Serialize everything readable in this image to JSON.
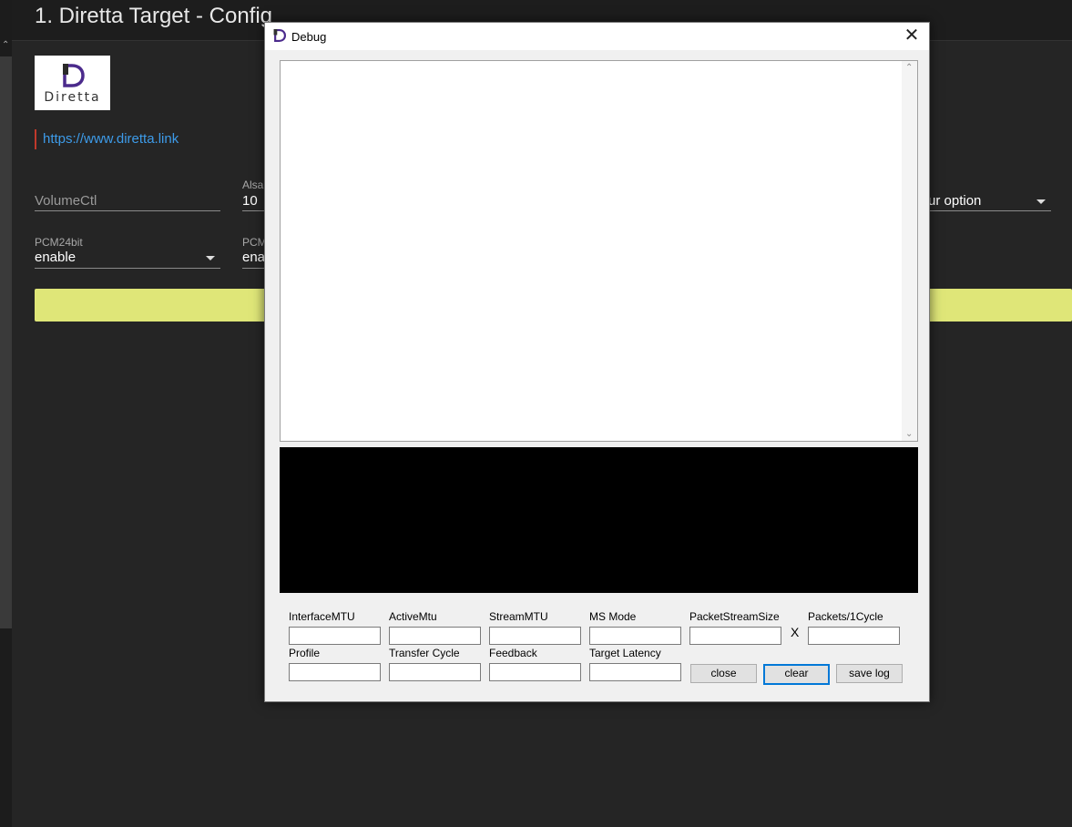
{
  "app": {
    "title": "1. Diretta Target - Config",
    "logo_text": "Diretta",
    "link": "https://www.diretta.link"
  },
  "form": {
    "volumectl_placeholder": "VolumeCtl",
    "alsa_label": "Alsa",
    "alsa_value": "10",
    "option_placeholder": "ur option",
    "pcm24_label": "PCM24bit",
    "pcm24_value": "enable",
    "pcm_label": "PCM",
    "pcm_value": "ena"
  },
  "dialog": {
    "title": "Debug",
    "close_glyph": "✕",
    "fields_row1": [
      "InterfaceMTU",
      "ActiveMtu",
      "StreamMTU",
      "MS Mode",
      "PacketStreamSize",
      "Packets/1Cycle"
    ],
    "fields_row2": [
      "Profile",
      "Transfer Cycle",
      "Feedback",
      "Target Latency"
    ],
    "times_sign": "X",
    "buttons": {
      "close": "close",
      "clear": "clear",
      "save_log": "save log"
    }
  },
  "colors": {
    "accent_yellow": "#dfe678",
    "link": "#3d9be9",
    "logo_purple": "#4b2a8c"
  }
}
